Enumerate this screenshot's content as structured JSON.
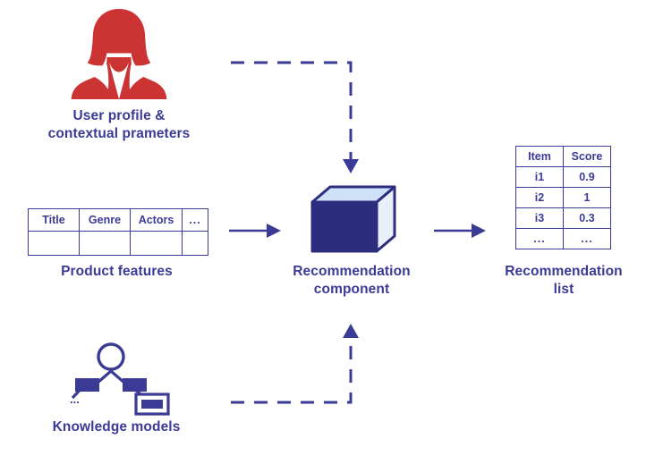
{
  "theme": {
    "text_color": "#3b3b96",
    "accent_navy": "#2d2d7f",
    "user_icon_red": "#cc3333",
    "cube_front": "#2d2d7f",
    "cube_top": "#cfe2f7",
    "cube_side": "#e8f1fb",
    "background": "#ffffff"
  },
  "nodes": {
    "user_profile": {
      "icon": "female-user-silhouette-icon",
      "label_line1": "User profile &",
      "label_line2": "contextual prameters",
      "label": "User profile &\ncontextual prameters"
    },
    "product_features": {
      "label": "Product features",
      "table": {
        "headers": [
          "Title",
          "Genre",
          "Actors",
          "..."
        ],
        "rows": [
          [
            "",
            "",
            "",
            ""
          ]
        ]
      }
    },
    "recommendation_component": {
      "icon": "3d-cube-icon",
      "label_line1": "Recommendation",
      "label_line2": "component",
      "label": "Recommendation\ncomponent"
    },
    "recommendation_list": {
      "label_line1": "Recommendation",
      "label_line2": "list",
      "label": "Recommendation\nlist",
      "table": {
        "headers": [
          "Item",
          "Score"
        ],
        "rows": [
          [
            "i1",
            "0.9"
          ],
          [
            "i2",
            "1"
          ],
          [
            "i3",
            "0.3"
          ],
          [
            "...",
            "..."
          ]
        ]
      }
    },
    "knowledge_models": {
      "icon": "knowledge-graph-icon",
      "label": "Knowledge models",
      "ellipsis": "..."
    }
  },
  "connectors": [
    {
      "id": "features-to-component",
      "style": "solid",
      "direction": "right"
    },
    {
      "id": "component-to-list",
      "style": "solid",
      "direction": "right"
    },
    {
      "id": "user-to-component",
      "style": "dashed",
      "direction": "down"
    },
    {
      "id": "knowledge-to-component",
      "style": "dashed",
      "direction": "up"
    }
  ]
}
